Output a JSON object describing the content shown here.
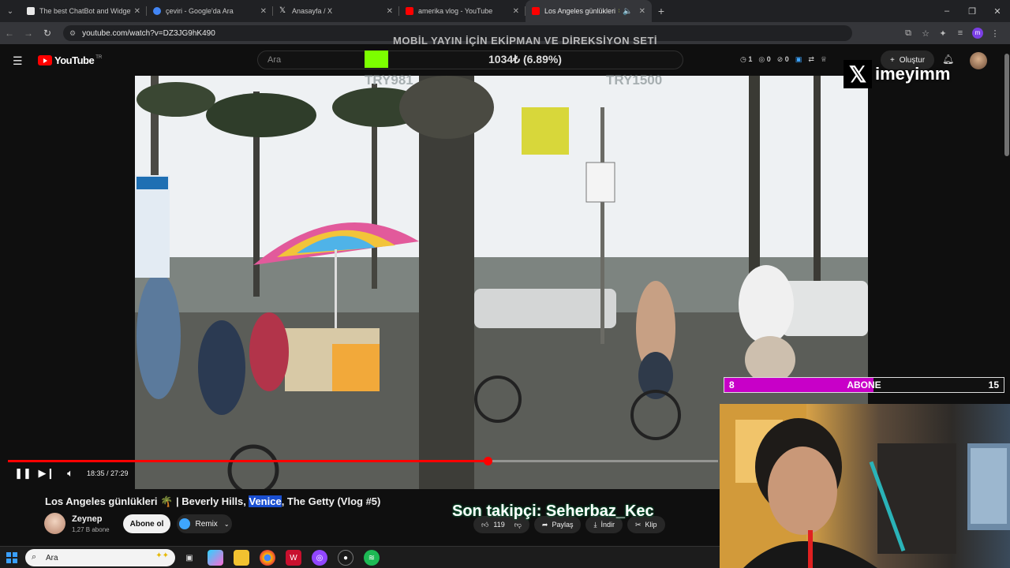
{
  "browser": {
    "tabs": [
      {
        "title": "The best ChatBot and Widgets",
        "fav_color": "#e8e8e8"
      },
      {
        "title": "çeviri - Google'da Ara",
        "fav_color": "#4285f4"
      },
      {
        "title": "Anasayfa / X",
        "fav_color": "#e8e8e8"
      },
      {
        "title": "amerika vlog - YouTube",
        "fav_color": "#ff0000"
      },
      {
        "title": "Los Angeles günlükleri 🌴 |",
        "fav_color": "#ff0000"
      }
    ],
    "url": "youtube.com/watch?v=DZ3JG9hK490"
  },
  "overlay": {
    "top_text": "MOBİL YAYIN İÇİN EKİPMAN VE DİREKSİYON SETİ",
    "counter": "1034₺ (6.89%)",
    "price_left": "TRY981",
    "price_right": "TRY1500",
    "x_handle": "imeyimm",
    "progress_fraction": 0.0689
  },
  "youtube": {
    "logo_text": "YouTube",
    "region": "TR",
    "search_placeholder": "Ara",
    "create_label": "Oluştur",
    "header_counts": [
      "1",
      "0",
      "0"
    ]
  },
  "player": {
    "current_time": "18:35",
    "duration": "27:29",
    "time_text": "18:35 / 27:29",
    "progress_fraction": 0.676
  },
  "video": {
    "title_before": "Los Angeles günlükleri 🌴 | Beverly Hills, ",
    "title_highlight": "Venice",
    "title_after": ", The Getty (Vlog #5)",
    "channel_name": "Zeynep",
    "subscribers": "1,27 B abone",
    "subscribe_label": "Abone ol",
    "remix_label": "Remix",
    "likes": "119",
    "share_label": "Paylaş",
    "download_label": "İndir",
    "clip_label": "Klip"
  },
  "stream": {
    "abone_label": "ABONE",
    "abone_current": "8",
    "abone_goal": "15",
    "abone_fraction": 0.533,
    "follower_text": "Son takipçi: Seherbaz_Kec"
  },
  "taskbar": {
    "search_label": "Ara"
  }
}
